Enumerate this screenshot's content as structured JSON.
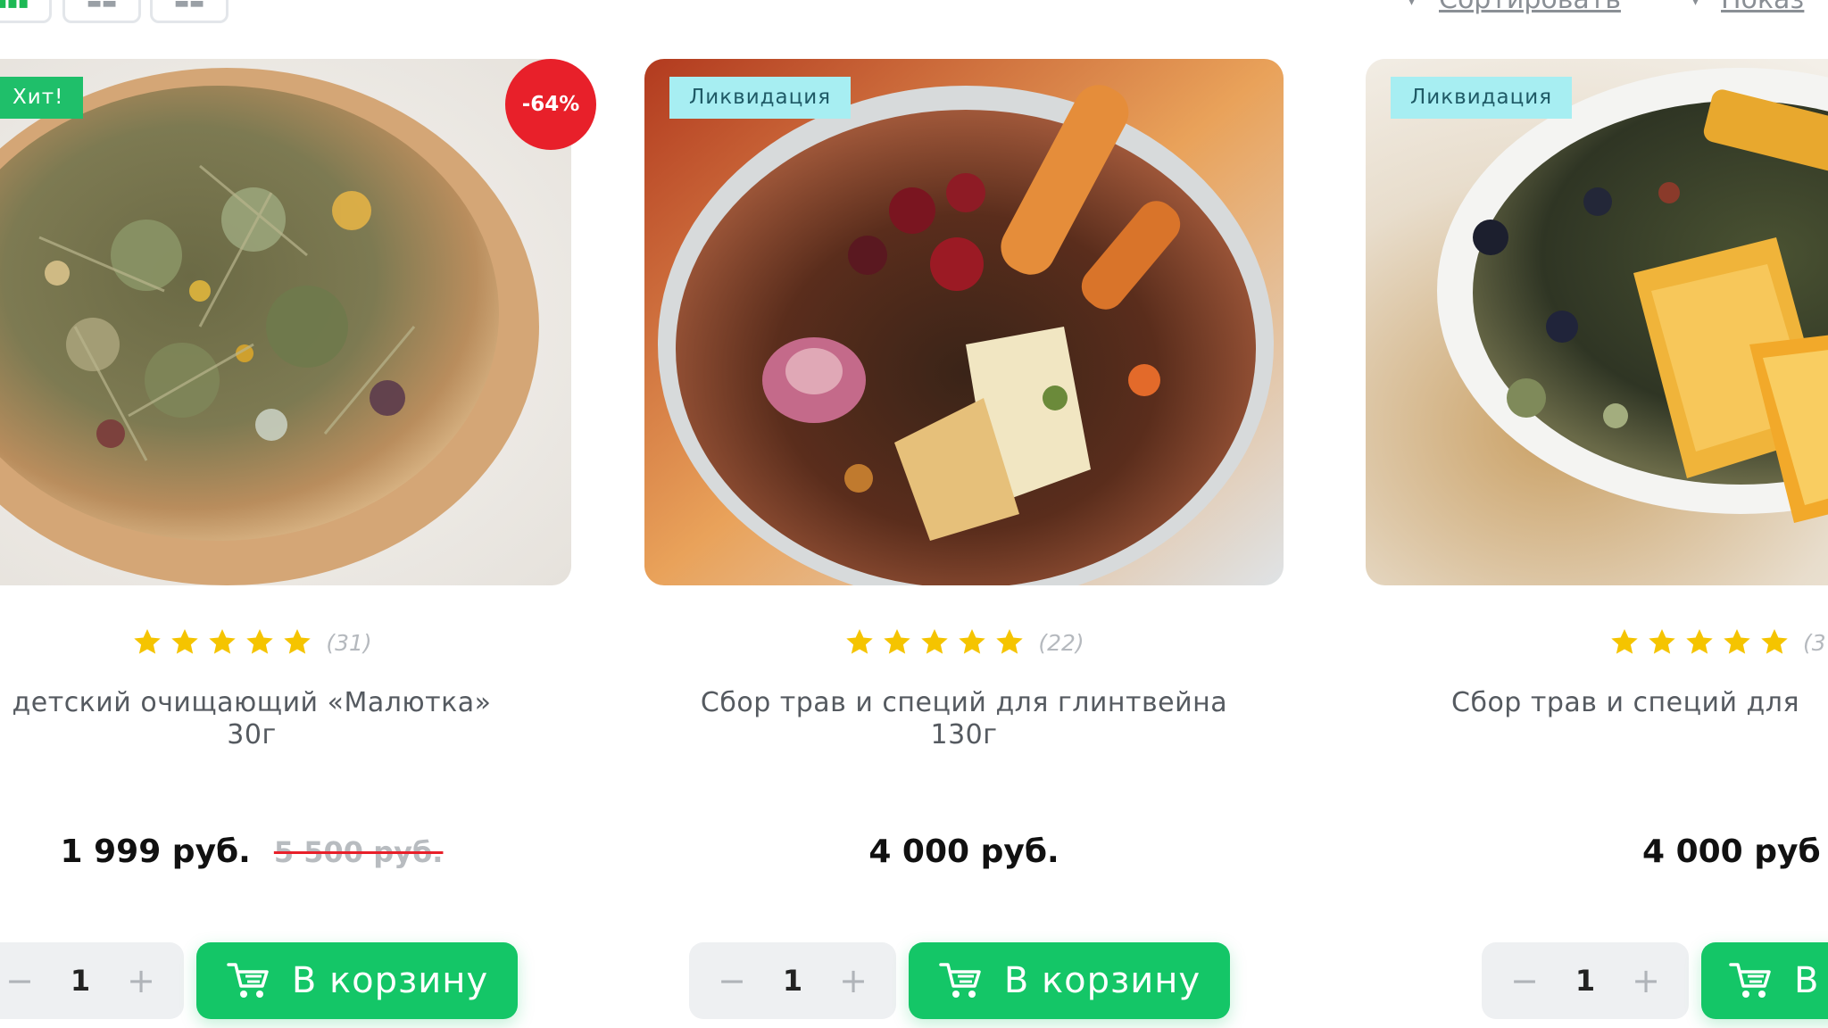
{
  "toolbar": {
    "view_modes": [
      "grid",
      "list",
      "compact"
    ],
    "active_view": "grid",
    "sort_label": "Сортировать",
    "show_label": "Показ"
  },
  "colors": {
    "accent_green": "#14c667",
    "badge_hit": "#1fbf6a",
    "badge_liquidation": "#a7eef2",
    "discount_red": "#e8202a",
    "star": "#f5c400"
  },
  "products": [
    {
      "badge": "Хит!",
      "discount": "-64%",
      "rating_value": 5,
      "reviews": "(31)",
      "title_line1": "детский очищающий «Малютка»",
      "title_line2": "30г",
      "price": "1 999 руб.",
      "old_price": "5 500 руб.",
      "quantity": "1",
      "cart_label": "В корзину",
      "image_icon": "herbal-tea-bowl-image"
    },
    {
      "badge": "Ликвидация",
      "discount": "",
      "rating_value": 5,
      "reviews": "(22)",
      "title_line1": "Сбор трав и специй для глинтвейна",
      "title_line2": "130г",
      "price": "4 000 руб.",
      "old_price": "",
      "quantity": "1",
      "cart_label": "В корзину",
      "image_icon": "mulled-wine-glass-image"
    },
    {
      "badge": "Ликвидация",
      "discount": "",
      "rating_value": 5,
      "reviews": "(3",
      "title_line1": "Сбор трав и специй для",
      "title_line2": "",
      "price": "4 000 руб",
      "old_price": "",
      "quantity": "1",
      "cart_label": "В",
      "image_icon": "herbal-tea-orange-bowl-image"
    }
  ]
}
